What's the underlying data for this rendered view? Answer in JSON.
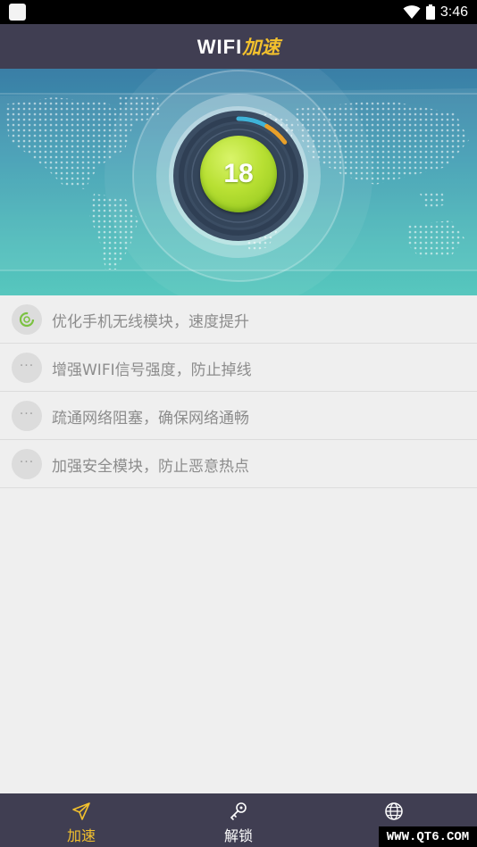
{
  "status_bar": {
    "time": "3:46"
  },
  "header": {
    "title_latin": "WIFI",
    "title_cn": "加速"
  },
  "hero": {
    "score": "18",
    "progress": 0.15
  },
  "tasks": [
    {
      "label": "优化手机无线模块，速度提升",
      "state": "in-progress",
      "icon": "spinner-icon"
    },
    {
      "label": "增强WIFI信号强度，防止掉线",
      "state": "pending",
      "icon": "ellipsis-icon"
    },
    {
      "label": "疏通网络阻塞，确保网络通畅",
      "state": "pending",
      "icon": "ellipsis-icon"
    },
    {
      "label": "加强安全模块，防止恶意热点",
      "state": "pending",
      "icon": "ellipsis-icon"
    }
  ],
  "task_dots": "···",
  "bottom_nav": {
    "items": [
      {
        "label": "加速",
        "icon": "send-icon",
        "active": true
      },
      {
        "label": "解锁",
        "icon": "key-icon",
        "active": false
      },
      {
        "label": "",
        "icon": "globe-icon",
        "active": false
      }
    ]
  },
  "watermark": "WWW.QT6.COM",
  "colors": {
    "header_bg": "#403e52",
    "accent_yellow": "#f3c12d",
    "score_green": "#b8e033",
    "progress_orange": "#e8a02a",
    "progress_blue": "#3fb3d8",
    "list_bg": "#efefef"
  }
}
